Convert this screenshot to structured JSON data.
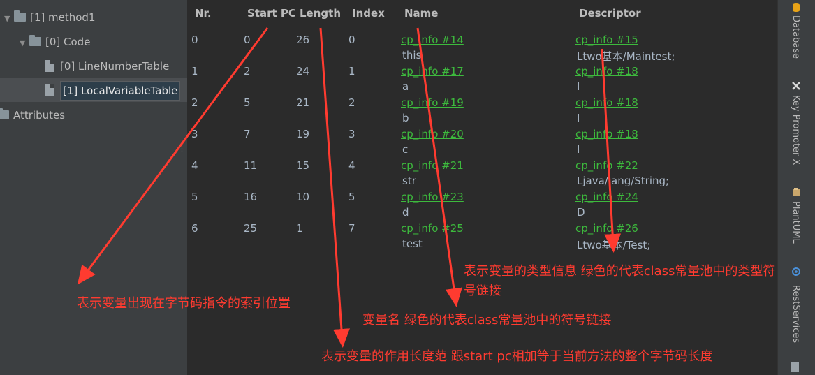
{
  "tree": {
    "items": [
      {
        "label": "[1] method1"
      },
      {
        "label": "[0] Code"
      },
      {
        "label": "[0] LineNumberTable"
      },
      {
        "label": "[1] LocalVariableTable"
      },
      {
        "label": "Attributes"
      }
    ]
  },
  "table": {
    "headers": [
      "Nr.",
      "Start PC",
      "Length",
      "Index",
      "Name",
      "Descriptor"
    ],
    "rows": [
      {
        "nr": "0",
        "start_pc": "0",
        "length": "26",
        "index": "0",
        "name_ref": "cp_info #14",
        "name": "this",
        "desc_ref": "cp_info #15",
        "desc": "Ltwo基本/Maintest;"
      },
      {
        "nr": "1",
        "start_pc": "2",
        "length": "24",
        "index": "1",
        "name_ref": "cp_info #17",
        "name": "a",
        "desc_ref": "cp_info #18",
        "desc": "I"
      },
      {
        "nr": "2",
        "start_pc": "5",
        "length": "21",
        "index": "2",
        "name_ref": "cp_info #19",
        "name": "b",
        "desc_ref": "cp_info #18",
        "desc": "I"
      },
      {
        "nr": "3",
        "start_pc": "7",
        "length": "19",
        "index": "3",
        "name_ref": "cp_info #20",
        "name": "c",
        "desc_ref": "cp_info #18",
        "desc": "I"
      },
      {
        "nr": "4",
        "start_pc": "11",
        "length": "15",
        "index": "4",
        "name_ref": "cp_info #21",
        "name": "str",
        "desc_ref": "cp_info #22",
        "desc": "Ljava/lang/String;"
      },
      {
        "nr": "5",
        "start_pc": "16",
        "length": "10",
        "index": "5",
        "name_ref": "cp_info #23",
        "name": "d",
        "desc_ref": "cp_info #24",
        "desc": "D"
      },
      {
        "nr": "6",
        "start_pc": "25",
        "length": "1",
        "index": "7",
        "name_ref": "cp_info #25",
        "name": "test",
        "desc_ref": "cp_info #26",
        "desc": "Ltwo基本/Test;"
      }
    ]
  },
  "tool_strip": {
    "tabs": [
      {
        "label": "Database",
        "icon": "database-icon"
      },
      {
        "label": "Key Promoter X",
        "icon": "key-promoter-icon"
      },
      {
        "label": "PlantUML",
        "icon": "plantuml-icon"
      },
      {
        "label": "RestServices",
        "icon": "rest-services-icon"
      }
    ]
  },
  "annotations": {
    "start_pc": "表示变量出现在字节码指令的索引位置",
    "descriptor_line1": "表示变量的类型信息 绿色的代表class常量池中的类型符",
    "descriptor_line2": "号链接",
    "name": "变量名 绿色的代表class常量池中的符号链接",
    "length": "表示变量的作用长度范 跟start pc相加等于当前方法的整个字节码长度"
  },
  "colors": {
    "background": "#2b2b2b",
    "panel": "#3c3f41",
    "link_green": "#3dba3d",
    "annotation_red": "#ff3b30"
  }
}
